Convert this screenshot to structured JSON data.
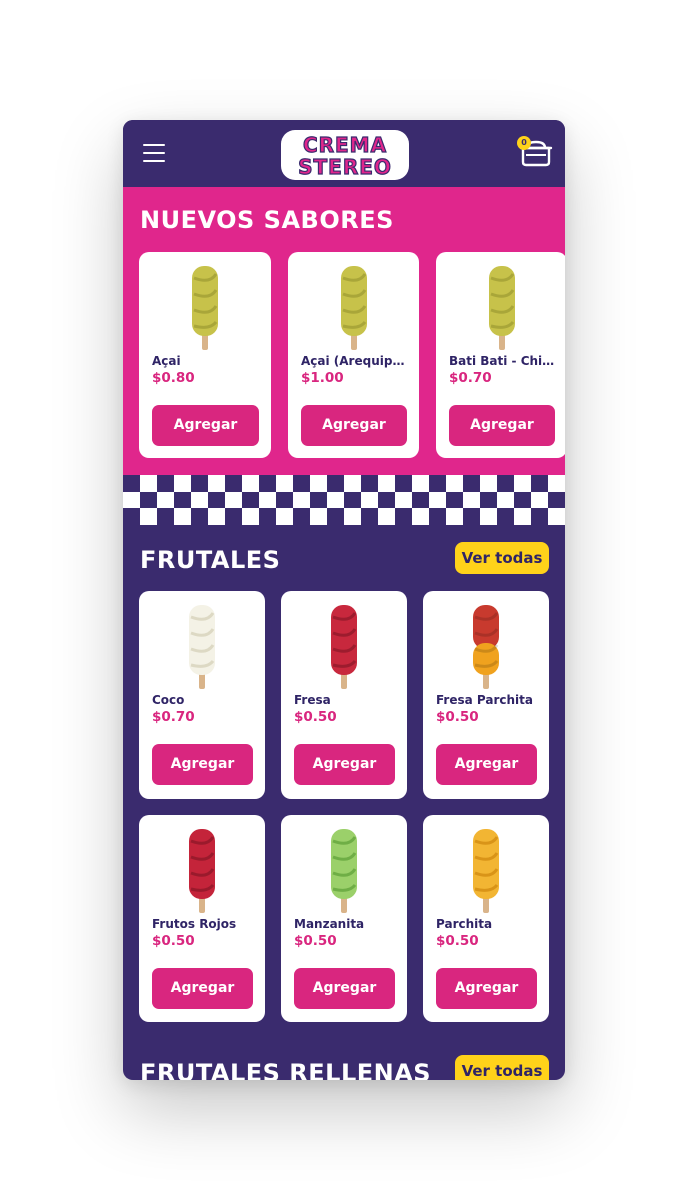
{
  "header": {
    "menu_icon": "hamburger-menu-icon",
    "logo_line1": "CREMA",
    "logo_line2": "STEREO",
    "cart_icon": "cart-icon",
    "cart_count": "0"
  },
  "nuevos": {
    "title": "NUEVOS SABORES",
    "items": [
      {
        "name": "Açai",
        "price": "$0.80",
        "button": "Agregar",
        "colors": [
          "#c7c24a",
          "#a9a639"
        ]
      },
      {
        "name": "Açai (Arequipe ...",
        "price": "$1.00",
        "button": "Agregar",
        "colors": [
          "#c7c24a",
          "#a9a639"
        ]
      },
      {
        "name": "Bati Bati - Chic...",
        "price": "$0.70",
        "button": "Agregar",
        "colors": [
          "#c7c24a",
          "#a9a639"
        ]
      }
    ]
  },
  "frutales": {
    "title": "FRUTALES",
    "see_all": "Ver todas",
    "items": [
      {
        "name": "Coco",
        "price": "$0.70",
        "button": "Agregar",
        "colors": [
          "#f4f2e6",
          "#ddd9c4"
        ]
      },
      {
        "name": "Fresa",
        "price": "$0.50",
        "button": "Agregar",
        "colors": [
          "#c8283d",
          "#9d1c2e"
        ]
      },
      {
        "name": "Fresa Parchita",
        "price": "$0.50",
        "button": "Agregar",
        "colors": [
          "#c83a2e",
          "#f0a21e"
        ]
      },
      {
        "name": "Frutos Rojos",
        "price": "$0.50",
        "button": "Agregar",
        "colors": [
          "#c4243a",
          "#9a1a2c"
        ]
      },
      {
        "name": "Manzanita",
        "price": "$0.50",
        "button": "Agregar",
        "colors": [
          "#9bd06a",
          "#6fae46"
        ]
      },
      {
        "name": "Parchita",
        "price": "$0.50",
        "button": "Agregar",
        "colors": [
          "#f2b533",
          "#d99418"
        ]
      }
    ]
  },
  "frutales_rellenas": {
    "title": "FRUTALES RELLENAS",
    "see_all": "Ver todas"
  },
  "colors": {
    "header_bg": "#3a2b6e",
    "pink": "#e0268c",
    "button": "#d9267f",
    "yellow": "#ffd21a"
  }
}
